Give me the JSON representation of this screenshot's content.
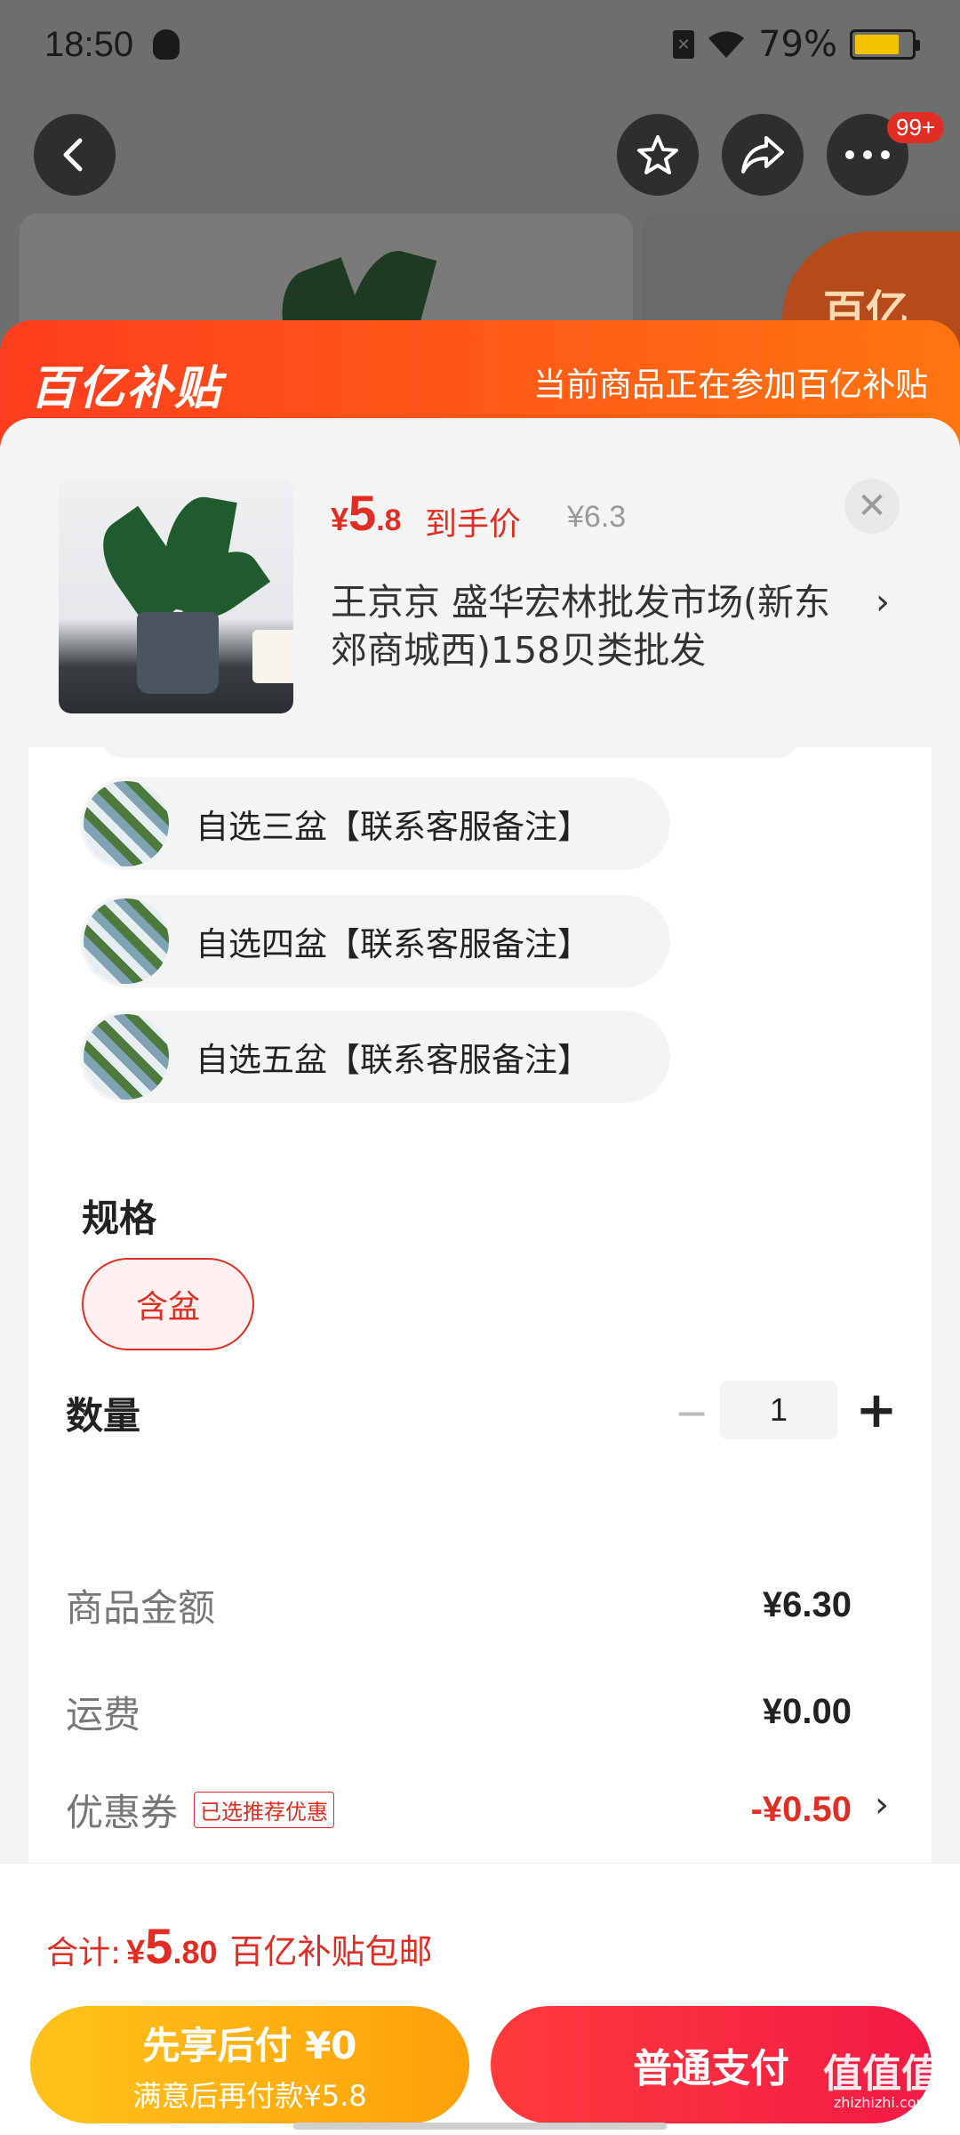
{
  "status_bar": {
    "time": "18:50",
    "battery": "79%",
    "battery_level": 0.79
  },
  "nav": {
    "more_badge": "99+"
  },
  "background": {
    "badge_text": "百亿"
  },
  "promo_header": {
    "brand": "百亿补贴",
    "note": "当前商品正在参加百亿补贴"
  },
  "product": {
    "price_symbol": "¥",
    "price_int": "5",
    "price_dec": ".8",
    "price_label": "到手价",
    "original_price": "¥6.3",
    "close": "✕",
    "shop": "王京京  盛华宏林批发市场(新东郊商城西)158贝类批发",
    "arrow": "›"
  },
  "variants": [
    {
      "label": "自选三盆【联系客服备注】"
    },
    {
      "label": "自选四盆【联系客服备注】"
    },
    {
      "label": "自选五盆【联系客服备注】"
    }
  ],
  "spec": {
    "title": "规格",
    "option": "含盆"
  },
  "quantity": {
    "title": "数量",
    "minus": "−",
    "value": "1",
    "plus": "+"
  },
  "summary": {
    "goods_label": "商品金额",
    "goods_value": "¥6.30",
    "shipping_label": "运费",
    "shipping_value": "¥0.00",
    "coupon_label": "优惠券",
    "coupon_tag": "已选推荐优惠",
    "coupon_value": "-¥0.50",
    "coupon_arrow": "›"
  },
  "footer": {
    "total_label": "合计:",
    "total_symbol": "¥",
    "total_int": "5",
    "total_dec": ".80",
    "total_note": "百亿补贴包邮",
    "later_line1": "先享后付 ¥0",
    "later_line2": "满意后再付款¥5.8",
    "pay_label": "普通支付"
  },
  "watermark": {
    "logo": "值值值",
    "site": "zhizhizhi.com"
  }
}
